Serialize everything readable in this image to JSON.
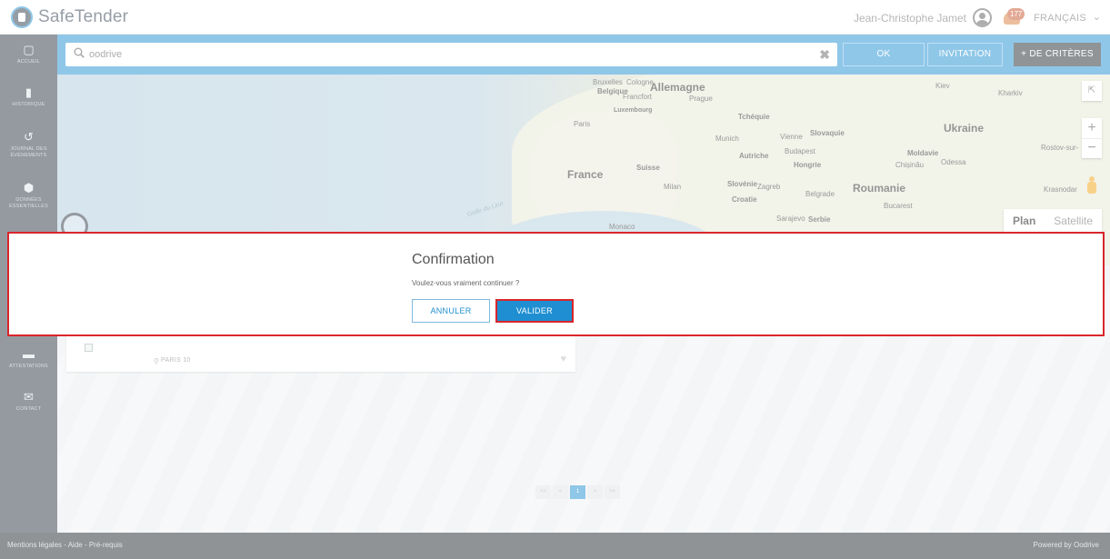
{
  "app": {
    "title": "SafeTender"
  },
  "header": {
    "user_name": "Jean-Christophe Jamet",
    "notification_count": "177",
    "language": "FRANÇAIS"
  },
  "sidebar": {
    "items": [
      {
        "label": "ACCUEIL",
        "icon": "home-icon"
      },
      {
        "label": "HISTORIQUE",
        "icon": "history-icon"
      },
      {
        "label": "JOURNAL DES ÉVÉNEMENTS",
        "icon": "clock-icon"
      },
      {
        "label": "DONNÉES ESSENTIELLES",
        "icon": "database-icon"
      },
      {
        "label": "ATTESTATIONS",
        "icon": "folder-icon"
      },
      {
        "label": "CONTACT",
        "icon": "envelope-icon"
      }
    ]
  },
  "search": {
    "value": "oodrive",
    "ok_label": "OK",
    "invitation_label": "INVITATION",
    "criteria_label": "+ DE CRITÈRES"
  },
  "map": {
    "labels": [
      "Bruxelles",
      "Cologne",
      "Allemagne",
      "Belgique",
      "Francfort",
      "Prague",
      "Luxembourg",
      "Tchéquie",
      "Paris",
      "Munich",
      "Vienne",
      "Slovaquie",
      "Kiev",
      "Kharkiv",
      "Ukraine",
      "Budapest",
      "Autriche",
      "Hongrie",
      "Moldavie",
      "Chișinău",
      "Odessa",
      "Rostov-sur-",
      "France",
      "Suisse",
      "Milan",
      "Slovénie",
      "Zagreb",
      "Croatie",
      "Roumanie",
      "Belgrade",
      "Bucarest",
      "Krasnodar",
      "Sarajevo",
      "Serbie",
      "Monaco",
      "Golfe du Lion"
    ],
    "map_type": {
      "plan": "Plan",
      "satellite": "Satellite"
    },
    "zoom_in": "+",
    "zoom_out": "−"
  },
  "card": {
    "location": "PARIS 10"
  },
  "pagination": {
    "first": "<<",
    "prev": "<",
    "current": "1",
    "next": ">",
    "last": ">>"
  },
  "modal": {
    "title": "Confirmation",
    "message": "Voulez-vous vraiment continuer ?",
    "cancel_label": "ANNULER",
    "validate_label": "VALIDER"
  },
  "footer": {
    "links": "Mentions légales - Aide - Pré-requis",
    "powered_by": "Powered by Oodrive"
  },
  "colors": {
    "primary": "#1f8fd1",
    "sidebar": "#2a3540",
    "highlight": "#d9262b",
    "footer": "#1f262d"
  }
}
